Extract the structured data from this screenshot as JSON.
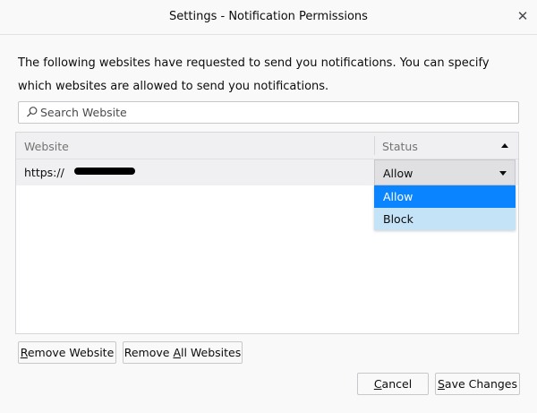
{
  "window": {
    "title": "Settings - Notification Permissions",
    "close_glyph": "✕"
  },
  "description": "The following websites have requested to send you notifications. You can specify which websites are allowed to send you notifications.",
  "search": {
    "placeholder": "Search Website",
    "value": "",
    "icon": "search-icon"
  },
  "table": {
    "columns": [
      {
        "label": "Website"
      },
      {
        "label": "Status",
        "sort": "ascending"
      }
    ],
    "rows": [
      {
        "website": "https://",
        "status": "Allow"
      }
    ]
  },
  "dropdown": {
    "options": [
      "Allow",
      "Block"
    ],
    "highlighted": "Allow"
  },
  "buttons": {
    "remove_website": {
      "first": "R",
      "rest": "emove Website"
    },
    "remove_all": {
      "first": "Remove ",
      "accel": "A",
      "rest": "ll Websites"
    },
    "cancel": {
      "first": "",
      "accel": "C",
      "rest": "ancel"
    },
    "save": {
      "first": "",
      "accel": "S",
      "rest": "ave Changes"
    }
  },
  "colors": {
    "accent": "#0a84ff",
    "menu_hover": "#c5e3f6"
  }
}
